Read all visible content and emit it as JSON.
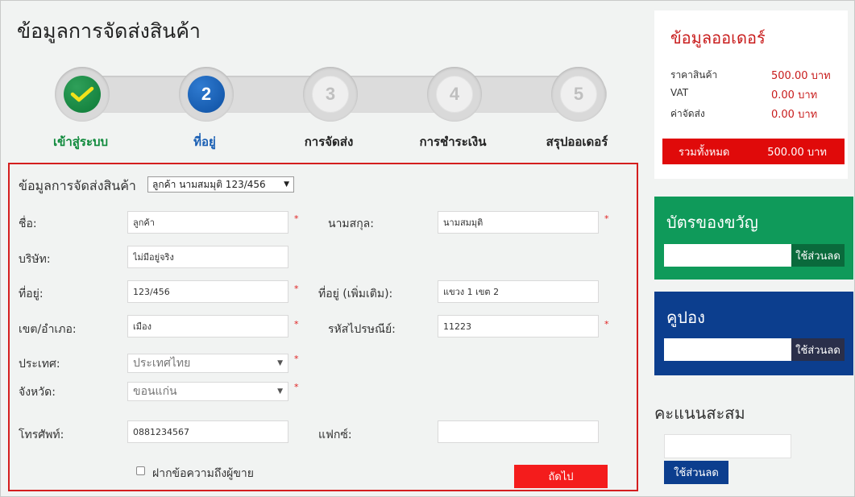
{
  "page": {
    "title": "ข้อมูลการจัดส่งสินค้า"
  },
  "stepper": {
    "steps": [
      {
        "number": "",
        "label": "เข้าสู่ระบบ",
        "state": "done"
      },
      {
        "number": "2",
        "label": "ที่อยู่",
        "state": "active"
      },
      {
        "number": "3",
        "label": "การจัดส่ง",
        "state": "todo"
      },
      {
        "number": "4",
        "label": "การชำระเงิน",
        "state": "todo"
      },
      {
        "number": "5",
        "label": "สรุปออเดอร์",
        "state": "todo"
      }
    ]
  },
  "form": {
    "heading": "ข้อมูลการจัดส่งสินค้า",
    "address_select": "ลูกค้า นามสมมุติ 123/456",
    "required_mark": "*",
    "fields": {
      "first_name": {
        "label": "ชื่อ:",
        "value": "ลูกค้า"
      },
      "last_name": {
        "label": "นามสกุล:",
        "value": "นามสมมุติ"
      },
      "company": {
        "label": "บริษัท:",
        "value": "ไม่มีอยู่จริง"
      },
      "address": {
        "label": "ที่อยู่:",
        "value": "123/456"
      },
      "address2": {
        "label": "ที่อยู่ (เพิ่มเติม):",
        "value": "แขวง 1 เขต 2"
      },
      "district": {
        "label": "เขต/อำเภอ:",
        "value": "เมือง"
      },
      "postcode": {
        "label": "รหัสไปรษณีย์:",
        "value": "11223"
      },
      "country": {
        "label": "ประเทศ:",
        "value": "ประเทศไทย"
      },
      "province": {
        "label": "จังหวัด:",
        "value": "ขอนแก่น"
      },
      "phone": {
        "label": "โทรศัพท์:",
        "value": "0881234567"
      },
      "fax": {
        "label": "แฟกซ์:",
        "value": ""
      }
    },
    "note_checkbox": "ฝากข้อความถึงผู้ขาย",
    "next_button": "ถัดไป"
  },
  "order": {
    "title": "ข้อมูลออเดอร์",
    "rows": [
      {
        "label": "ราคาสินค้า",
        "value": "500.00 บาท"
      },
      {
        "label": "VAT",
        "value": "0.00 บาท"
      },
      {
        "label": "ค่าจัดส่ง",
        "value": "0.00 บาท"
      }
    ],
    "total_label": "รวมทั้งหมด",
    "total_value": "500.00 บาท"
  },
  "gift": {
    "title": "บัตรของขวัญ",
    "button": "ใช้ส่วนลด"
  },
  "coupon": {
    "title": "คูปอง",
    "button": "ใช้ส่วนลด"
  },
  "points": {
    "title": "คะแนนสะสม",
    "button": "ใช้ส่วนลด"
  },
  "colors": {
    "accent_red": "#e00a0a",
    "green": "#0f9a5a",
    "navy": "#0c3e8e",
    "active_blue": "#1a5fb4"
  }
}
